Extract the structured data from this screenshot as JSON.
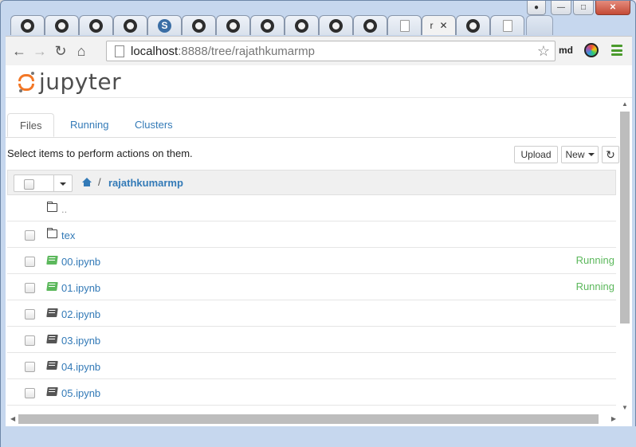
{
  "browser": {
    "tabs": [
      {
        "icon": "github-icon"
      },
      {
        "icon": "github-icon"
      },
      {
        "icon": "github-icon"
      },
      {
        "icon": "github-icon"
      },
      {
        "icon": "s-icon",
        "glyph": "S"
      },
      {
        "icon": "github-icon"
      },
      {
        "icon": "github-icon"
      },
      {
        "icon": "github-icon"
      },
      {
        "icon": "github-icon"
      },
      {
        "icon": "github-icon"
      },
      {
        "icon": "github-icon"
      },
      {
        "icon": "document-icon"
      },
      {
        "icon": "active",
        "label": "r",
        "close": "✕"
      },
      {
        "icon": "github-icon"
      },
      {
        "icon": "document-icon"
      }
    ],
    "address": {
      "host": "localhost",
      "rest": ":8888/tree/rajathkumarmp"
    },
    "profile_label": "md",
    "star_glyph": "☆",
    "back_glyph": "←",
    "forward_glyph": "→",
    "reload_glyph": "↻",
    "home_glyph": "⌂"
  },
  "jupyter": {
    "logo_text": "jupyter",
    "tabs": {
      "files": "Files",
      "running": "Running",
      "clusters": "Clusters"
    },
    "hint": "Select items to perform actions on them.",
    "upload_label": "Upload",
    "new_label": "New",
    "refresh_glyph": "↻",
    "breadcrumb_sep": "/",
    "breadcrumb_dir": "rajathkumarmp",
    "rows": [
      {
        "name": "..",
        "type": "parent"
      },
      {
        "name": "tex",
        "type": "folder"
      },
      {
        "name": "00.ipynb",
        "type": "notebook-running",
        "status": "Running"
      },
      {
        "name": "01.ipynb",
        "type": "notebook-running",
        "status": "Running"
      },
      {
        "name": "02.ipynb",
        "type": "notebook"
      },
      {
        "name": "03.ipynb",
        "type": "notebook"
      },
      {
        "name": "04.ipynb",
        "type": "notebook"
      },
      {
        "name": "05.ipynb",
        "type": "notebook"
      }
    ]
  },
  "colors": {
    "link": "#337ab7",
    "running": "#5cb85c",
    "logo_orange": "#f37726"
  }
}
